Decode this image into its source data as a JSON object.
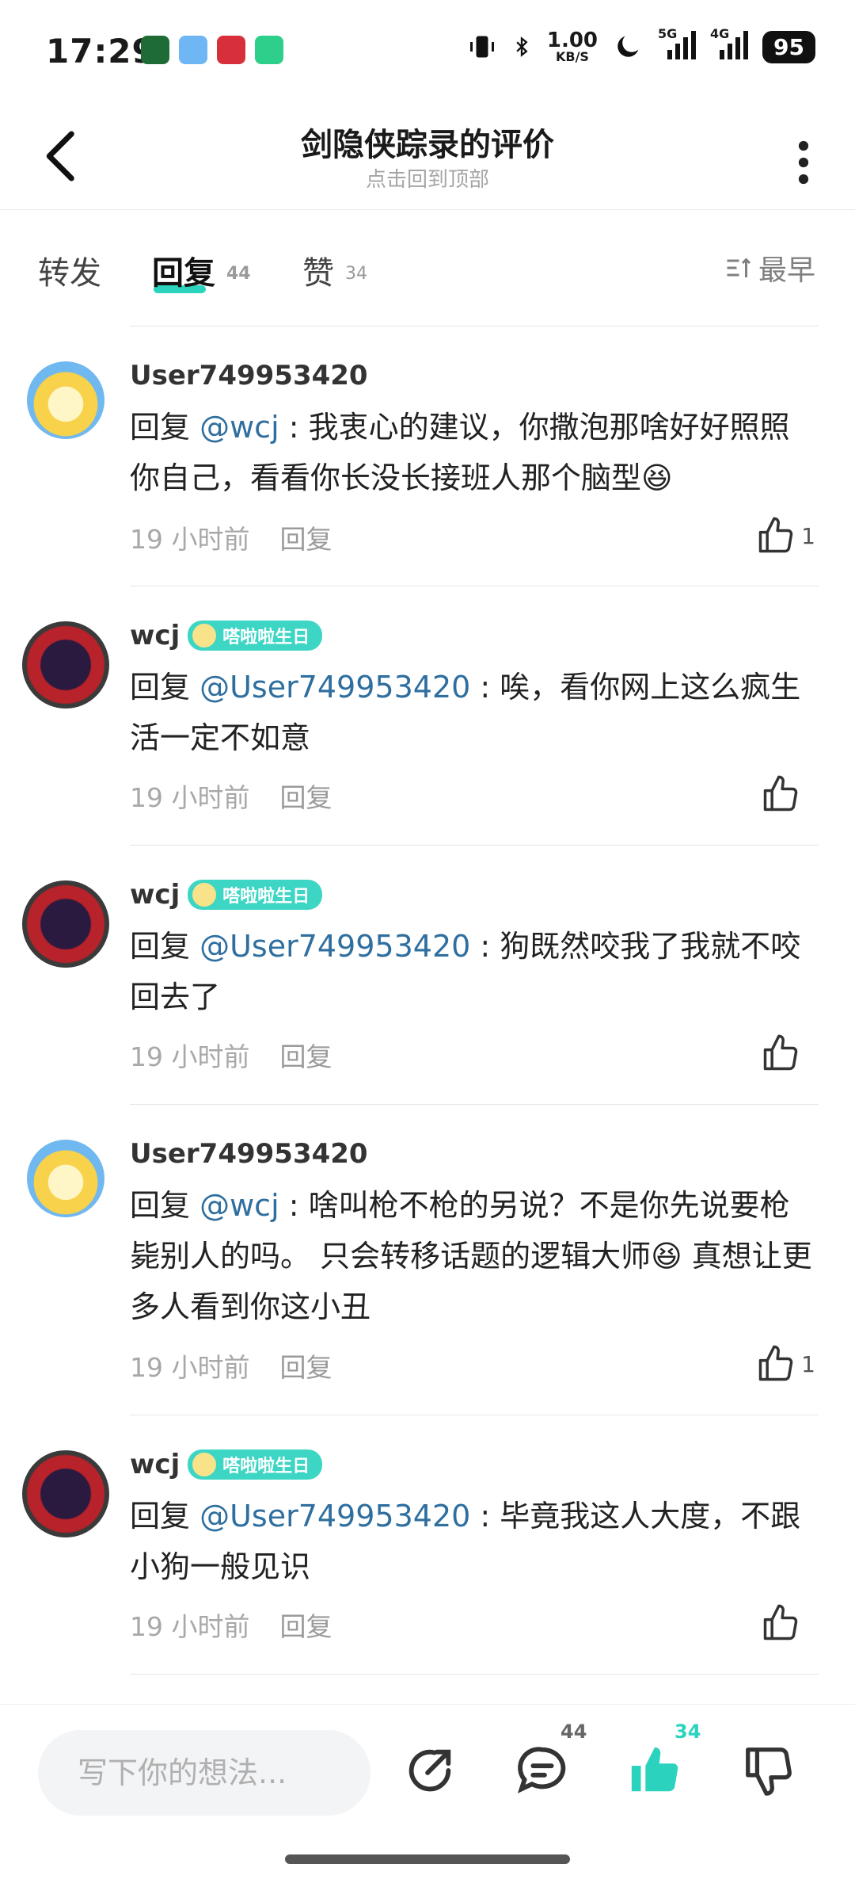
{
  "status": {
    "time": "17:29",
    "speed": "1.00",
    "speed_unit": "KB/S",
    "net1": "5G",
    "net2": "4G",
    "battery": "95"
  },
  "header": {
    "title": "剑隐侠踪录的评价",
    "subtitle": "点击回到顶部"
  },
  "tabs": [
    {
      "label": "转发",
      "count": ""
    },
    {
      "label": "回复",
      "count": "44"
    },
    {
      "label": "赞",
      "count": "34"
    }
  ],
  "sort_label": "最早",
  "comments": [
    {
      "user": "User749953420",
      "badge": "",
      "reply_prefix": "回复 ",
      "mention": "@wcj",
      "text": " : 我衷心的建议，你撒泡那啥好好照照你自己，看看你长没长接班人那个脑型😆",
      "time": "19 小时前",
      "reply_label": "回复",
      "likes": "1"
    },
    {
      "user": "wcj",
      "badge": "嗒啦啦生日",
      "reply_prefix": "回复 ",
      "mention": "@User749953420",
      "text": " : 唉，看你网上这么疯生活一定不如意",
      "time": "19 小时前",
      "reply_label": "回复",
      "likes": ""
    },
    {
      "user": "wcj",
      "badge": "嗒啦啦生日",
      "reply_prefix": "回复 ",
      "mention": "@User749953420",
      "text": " : 狗既然咬我了我就不咬回去了",
      "time": "19 小时前",
      "reply_label": "回复",
      "likes": ""
    },
    {
      "user": "User749953420",
      "badge": "",
      "reply_prefix": "回复 ",
      "mention": "@wcj",
      "text": " : 啥叫枪不枪的另说？不是你先说要枪毙别人的吗。 只会转移话题的逻辑大师😆 真想让更多人看到你这小丑",
      "time": "19 小时前",
      "reply_label": "回复",
      "likes": "1"
    },
    {
      "user": "wcj",
      "badge": "嗒啦啦生日",
      "reply_prefix": "回复 ",
      "mention": "@User749953420",
      "text": " : 毕竟我这人大度，不跟小狗一般见识",
      "time": "19 小时前",
      "reply_label": "回复",
      "likes": ""
    }
  ],
  "bottom": {
    "placeholder": "写下你的想法...",
    "comment_count": "44",
    "like_count": "34"
  },
  "colors": {
    "accent": "#2bd3be",
    "mention": "#2f6f9f"
  }
}
